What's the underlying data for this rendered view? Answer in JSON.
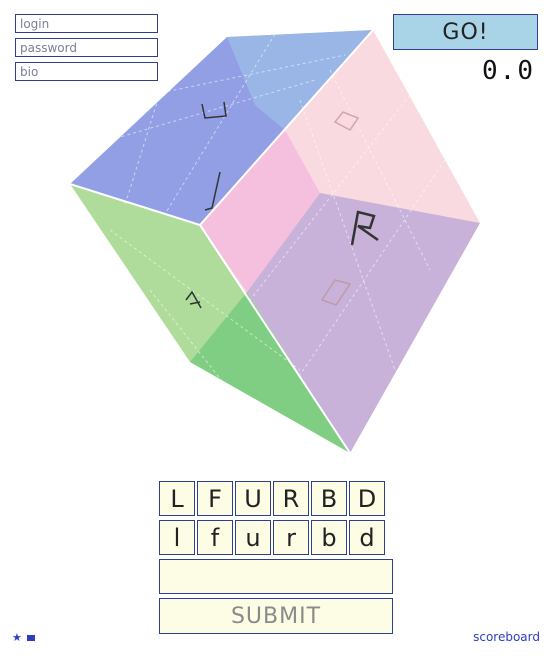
{
  "login_form": {
    "login_placeholder": "login",
    "password_placeholder": "password",
    "bio_placeholder": "bio"
  },
  "go_button": {
    "label": "GO!"
  },
  "score": {
    "value": "0.0"
  },
  "cube": {
    "faces": {
      "top_left": {
        "color": "#7f8ee0"
      },
      "top_right": {
        "color": "#f8d4dc"
      },
      "left": {
        "color": "#94d07a"
      },
      "right": {
        "color": "#c0aad7"
      },
      "inner_left": {
        "color": "#f4b9dc"
      },
      "inner_bottom": {
        "color": "#6cc77a"
      }
    },
    "glyphs": [
      "U",
      "J",
      "A",
      "R",
      "D",
      "D"
    ]
  },
  "keypad": {
    "upper": [
      "L",
      "F",
      "U",
      "R",
      "B",
      "D"
    ],
    "lower": [
      "l",
      "f",
      "u",
      "r",
      "b",
      "d"
    ]
  },
  "answer": {
    "value": ""
  },
  "submit": {
    "label": "SUBMIT"
  },
  "footer": {
    "star_icon": "star-icon",
    "square_icon": "square-icon",
    "scoreboard_label": "scoreboard"
  },
  "colors": {
    "border": "#2d3f8f",
    "button_fill": "#fdfde6",
    "go_fill": "#a9d3e6",
    "link": "#2d3fbf"
  }
}
